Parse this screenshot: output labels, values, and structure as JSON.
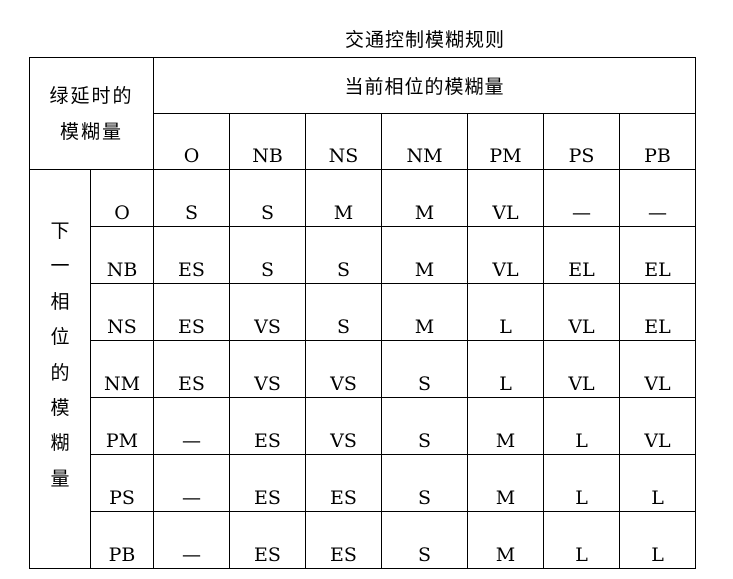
{
  "title": "交通控制模糊规则",
  "corner_label_line1": "绿延时的",
  "corner_label_line2": "模糊量",
  "column_group_label": "当前相位的模糊量",
  "row_group_label_chars": [
    "下",
    "一",
    "相",
    "位",
    "的",
    "模",
    "糊",
    "量"
  ],
  "columns": [
    "O",
    "NB",
    "NS",
    "NM",
    "PM",
    "PS",
    "PB"
  ],
  "rows": [
    {
      "label": "O",
      "values": [
        "S",
        "S",
        "M",
        "M",
        "VL",
        "—",
        "—"
      ]
    },
    {
      "label": "NB",
      "values": [
        "ES",
        "S",
        "S",
        "M",
        "VL",
        "EL",
        "EL"
      ]
    },
    {
      "label": "NS",
      "values": [
        "ES",
        "VS",
        "S",
        "M",
        "L",
        "VL",
        "EL"
      ]
    },
    {
      "label": "NM",
      "values": [
        "ES",
        "VS",
        "VS",
        "S",
        "L",
        "VL",
        "VL"
      ]
    },
    {
      "label": "PM",
      "values": [
        "—",
        "ES",
        "VS",
        "S",
        "M",
        "L",
        "VL"
      ]
    },
    {
      "label": "PS",
      "values": [
        "—",
        "ES",
        "ES",
        "S",
        "M",
        "L",
        "L"
      ]
    },
    {
      "label": "PB",
      "values": [
        "—",
        "ES",
        "ES",
        "S",
        "M",
        "L",
        "L"
      ]
    }
  ]
}
